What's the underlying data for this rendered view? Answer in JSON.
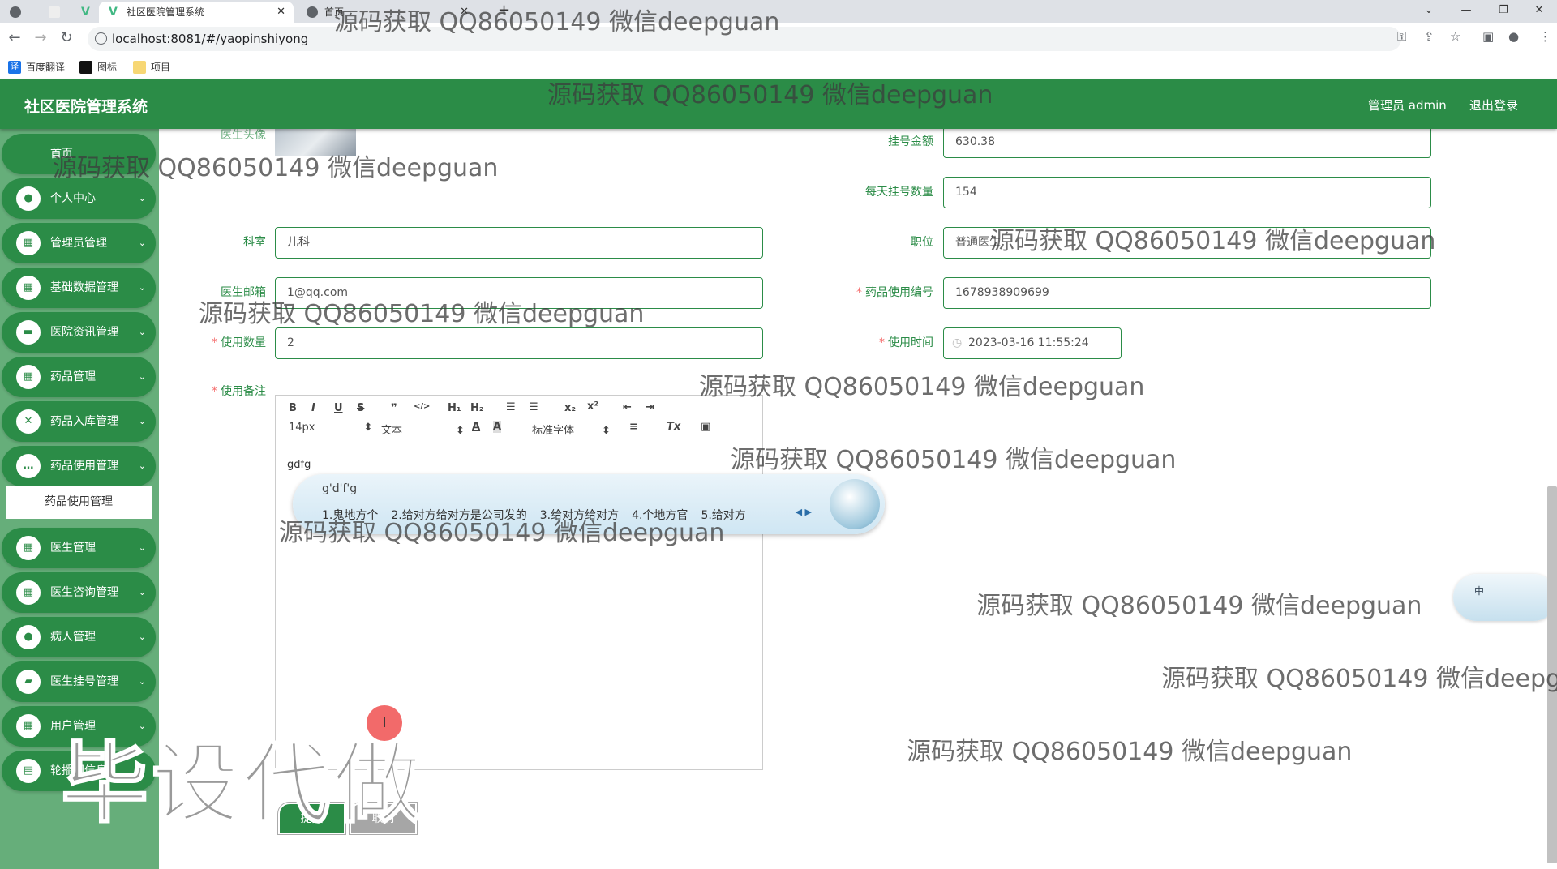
{
  "browser": {
    "tabs": [
      {
        "label": "社区医院管理系统",
        "active": true
      },
      {
        "label": "首页",
        "active": false
      }
    ],
    "url": "localhost:8081/#/yaopinshiyong",
    "bookmarks": [
      "百度翻译",
      "图标",
      "项目"
    ]
  },
  "header": {
    "title": "社区医院管理系统",
    "user": "管理员 admin",
    "logout": "退出登录"
  },
  "sidebar": {
    "home": "首页",
    "items": [
      {
        "label": "个人中心",
        "icon": "user-icon"
      },
      {
        "label": "管理员管理",
        "icon": "grid-icon"
      },
      {
        "label": "基础数据管理",
        "icon": "grid-icon"
      },
      {
        "label": "医院资讯管理",
        "icon": "monitor-icon"
      },
      {
        "label": "药品管理",
        "icon": "grid-icon"
      },
      {
        "label": "药品入库管理",
        "icon": "clipboard-x-icon"
      },
      {
        "label": "药品使用管理",
        "icon": "chat-icon"
      },
      {
        "label": "医生管理",
        "icon": "grid-icon"
      },
      {
        "label": "医生咨询管理",
        "icon": "grid-icon"
      },
      {
        "label": "病人管理",
        "icon": "bulb-icon"
      },
      {
        "label": "医生挂号管理",
        "icon": "ticket-icon"
      },
      {
        "label": "用户管理",
        "icon": "grid-icon"
      },
      {
        "label": "轮播图信息",
        "icon": "clipboard-icon"
      }
    ],
    "active_sub": "药品使用管理"
  },
  "form": {
    "avatar_label": "医生头像",
    "fee": {
      "label": "挂号金额",
      "value": "630.38"
    },
    "daily": {
      "label": "每天挂号数量",
      "value": "154"
    },
    "dept": {
      "label": "科室",
      "value": "儿科"
    },
    "title": {
      "label": "职位",
      "value": "普通医生"
    },
    "email": {
      "label": "医生邮箱",
      "value": "1@qq.com"
    },
    "code": {
      "label": "药品使用编号",
      "value": "1678938909699"
    },
    "qty": {
      "label": "使用数量",
      "value": "2"
    },
    "time": {
      "label": "使用时间",
      "value": "2023-03-16 11:55:24"
    },
    "note": {
      "label": "使用备注",
      "value": "gdfg"
    },
    "required_mark": "*",
    "submit": "提交",
    "cancel": "取消"
  },
  "editor": {
    "font_size": "14px",
    "block": "文本",
    "font": "标准字体"
  },
  "ime": {
    "composition": "g'd'f'g",
    "candidates": [
      "1.鬼地方个",
      "2.给对方给对方是公司发的",
      "3.给对方给对方",
      "4.个地方官",
      "5.给对方"
    ],
    "mode": "中"
  },
  "watermark": "源码获取 QQ86050149 微信deepguan",
  "overlay_text": "毕设代做"
}
